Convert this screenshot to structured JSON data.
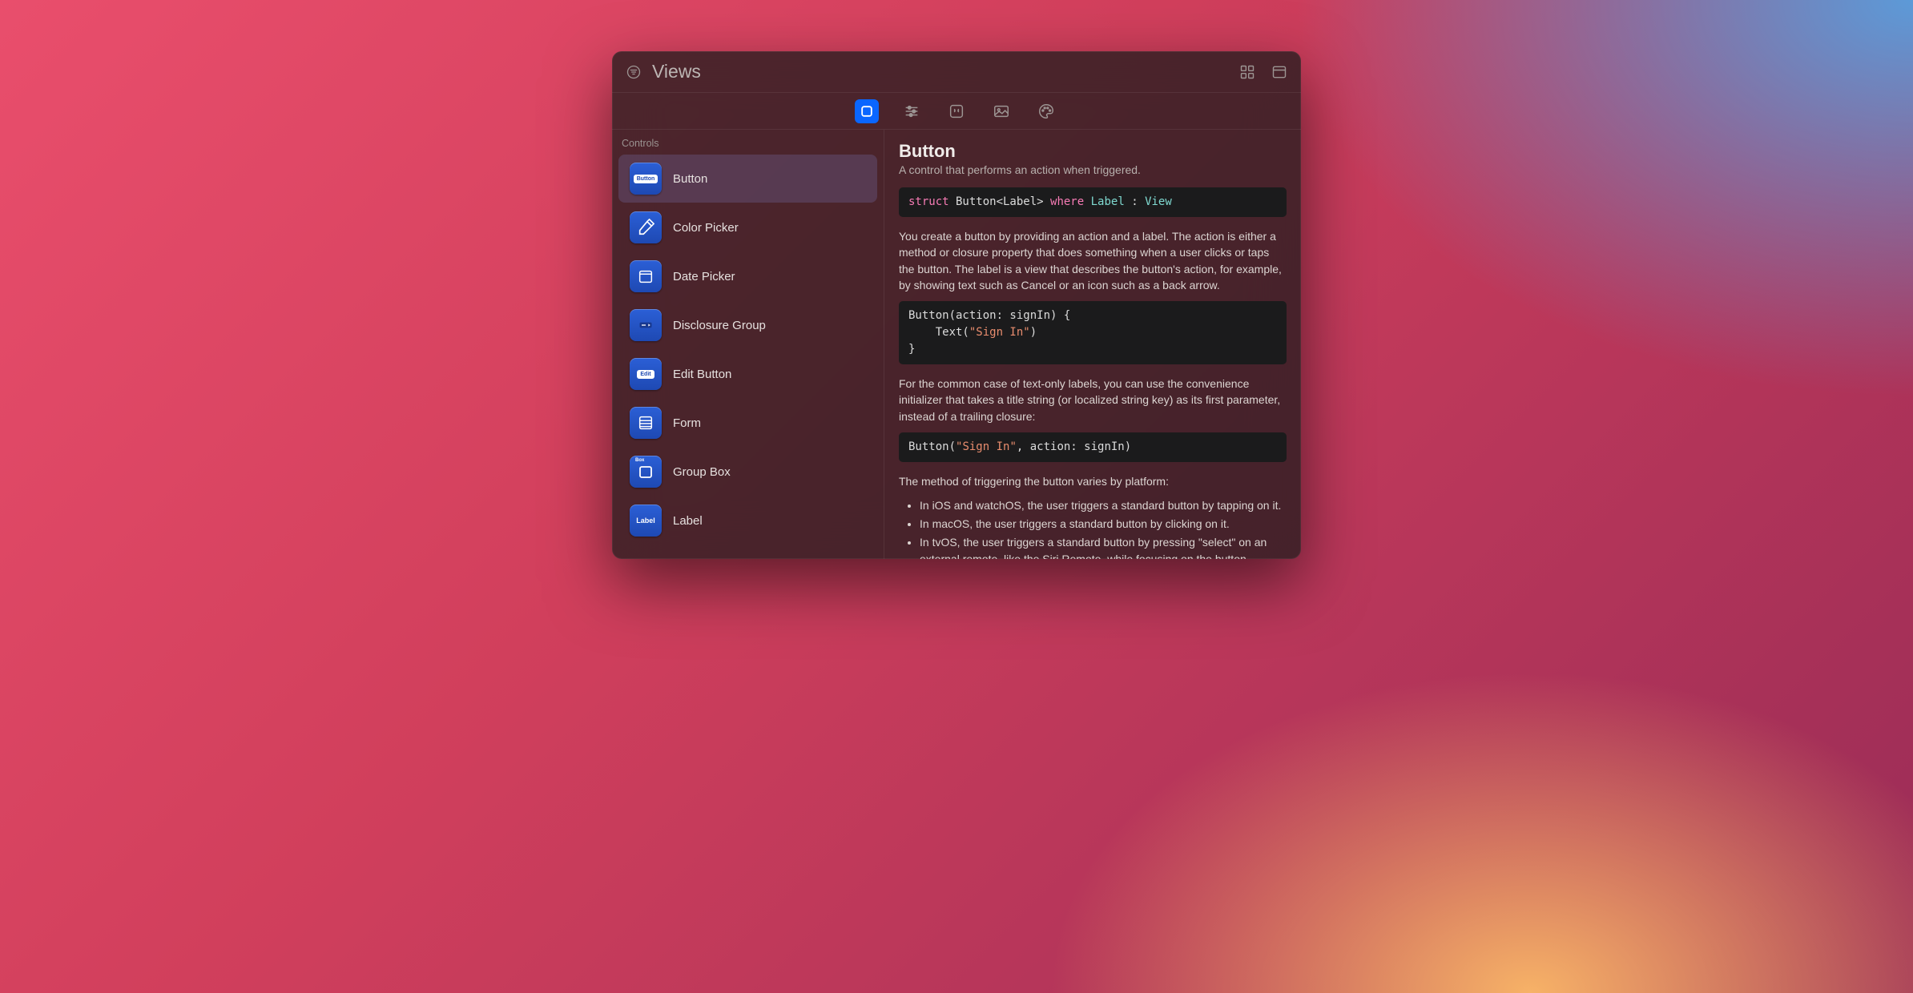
{
  "titlebar": {
    "placeholder": "Views"
  },
  "tabs": [
    {
      "id": "views",
      "active": true
    },
    {
      "id": "modifiers",
      "active": false
    },
    {
      "id": "snippets",
      "active": false
    },
    {
      "id": "media",
      "active": false
    },
    {
      "id": "colors",
      "active": false
    }
  ],
  "sidebar": {
    "section_label": "Controls",
    "items": [
      {
        "label": "Button",
        "icon_text": "Button",
        "selected": true
      },
      {
        "label": "Color Picker",
        "icon_text": "",
        "selected": false
      },
      {
        "label": "Date Picker",
        "icon_text": "",
        "selected": false
      },
      {
        "label": "Disclosure Group",
        "icon_text": "",
        "selected": false
      },
      {
        "label": "Edit Button",
        "icon_text": "Edit",
        "selected": false
      },
      {
        "label": "Form",
        "icon_text": "",
        "selected": false
      },
      {
        "label": "Group Box",
        "icon_text": "Box",
        "selected": false
      },
      {
        "label": "Label",
        "icon_text": "Label",
        "selected": false
      }
    ]
  },
  "detail": {
    "title": "Button",
    "subtitle": "A control that performs an action when triggered.",
    "declaration_plain": "struct Button<Label> where Label : View",
    "paragraph1": "You create a button by providing an action and a label. The action is either a method or closure property that does something when a user clicks or taps the button. The label is a view that describes the button's action, for example, by showing text such as Cancel or an icon such as a back arrow.",
    "code1_plain": "Button(action: signIn) {\n    Text(\"Sign In\")\n}",
    "paragraph2": "For the common case of text-only labels, you can use the convenience initializer that takes a title string (or localized string key) as its first parameter, instead of a trailing closure:",
    "code2_plain": "Button(\"Sign In\", action: signIn)",
    "paragraph3": "The method of triggering the button varies by platform:",
    "bullets": [
      "In iOS and watchOS, the user triggers a standard button by tapping on it.",
      "In macOS, the user triggers a standard button by clicking on it.",
      "In tvOS, the user triggers a standard button by pressing \"select\" on an external remote, like the Siri Remote, while focusing on the button."
    ]
  }
}
